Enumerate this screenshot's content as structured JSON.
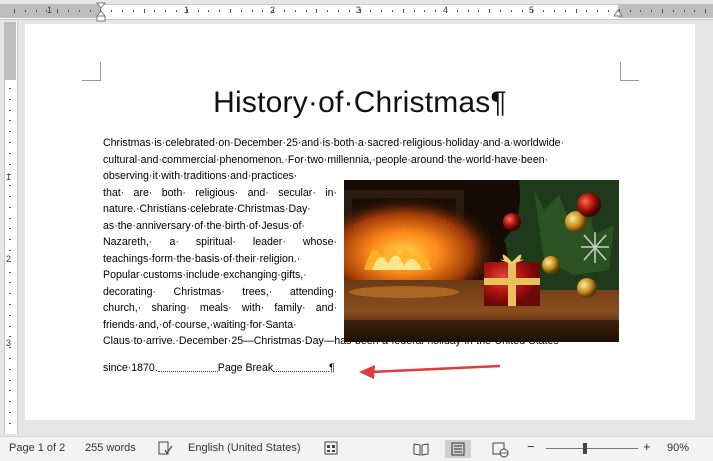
{
  "ruler": {
    "h_numbers": [
      "1",
      "1",
      "2",
      "3",
      "4",
      "5"
    ],
    "v_numbers": [
      "1",
      "2",
      "3"
    ]
  },
  "document": {
    "title": "History·of·Christmas¶",
    "lines_full": [
      "Christmas·is·celebrated·on·December·25·and·is·both·a·sacred·religious·holiday·and·a·worldwide·",
      "cultural·and·commercial·phenomenon.·For·two·millennia,·people·around·the·world·have·been·"
    ],
    "lines_wrap": [
      "observing·it·with·traditions·and·practices·",
      "that· are· both· religious· and· secular· in·",
      "nature.·Christians·celebrate·Christmas·Day·",
      "as·the·anniversary·of·the·birth·of·Jesus·of·",
      "Nazareth,· a· spiritual· leader· whose·",
      "teachings·form·the·basis·of·their·religion.·",
      "Popular·customs·include·exchanging·gifts,·",
      "decorating· Christmas· trees,· attending·",
      "church,· sharing· meals· with· family· and·",
      "friends·and,·of·course,·waiting·for·Santa·"
    ],
    "line_after": "Claus·to·arrive.·December·25—Christmas·Day—has·been·a·federal·holiday·in·the·United·States·",
    "last_line": "since·1870.",
    "page_break_label": "Page Break",
    "pilcrow": "¶"
  },
  "statusbar": {
    "page": "Page 1 of 2",
    "words": "255 words",
    "language": "English (United States)",
    "zoom_minus": "−",
    "zoom_plus": "+",
    "zoom": "90%"
  },
  "icons": [
    "proofing-icon",
    "accessibility-icon",
    "read-mode-icon",
    "print-layout-icon",
    "web-layout-icon"
  ]
}
